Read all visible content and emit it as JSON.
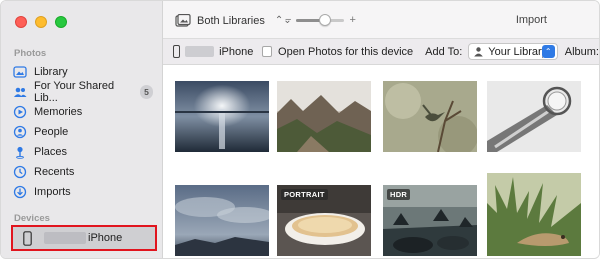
{
  "sidebar": {
    "photos_section": "Photos",
    "items": [
      {
        "label": "Library",
        "icon": "library-icon"
      },
      {
        "label": "For Your Shared Lib...",
        "icon": "shared-people-icon",
        "badge": "5"
      },
      {
        "label": "Memories",
        "icon": "memories-icon"
      },
      {
        "label": "People",
        "icon": "people-icon"
      },
      {
        "label": "Places",
        "icon": "places-pin-icon"
      },
      {
        "label": "Recents",
        "icon": "clock-icon"
      },
      {
        "label": "Imports",
        "icon": "imports-icon"
      }
    ],
    "devices_section": "Devices",
    "device": {
      "label": "iPhone",
      "icon": "phone-icon"
    }
  },
  "toolbar": {
    "library_filter": "Both Libraries",
    "zoom_minus": "−",
    "zoom_plus": "+",
    "zoom_level": 0.6,
    "import_label": "Import"
  },
  "importbar": {
    "device_label": "iPhone",
    "open_photos_label": "Open Photos for this device",
    "open_photos_checked": false,
    "add_to_label": "Add To:",
    "add_to_value": "Your Library",
    "album_label": "Album:"
  },
  "photos": [
    {
      "scene": "ocean-moon",
      "tag": ""
    },
    {
      "scene": "mountains",
      "tag": ""
    },
    {
      "scene": "hummingbird",
      "tag": ""
    },
    {
      "scene": "glass-bulb",
      "tag": ""
    },
    {
      "scene": "cloudy-sky",
      "tag": ""
    },
    {
      "scene": "pie",
      "tag": "PORTRAIT"
    },
    {
      "scene": "rocky-coast",
      "tag": "HDR"
    },
    {
      "scene": "lizard",
      "tag": ""
    }
  ],
  "colors": {
    "accent": "#2f7ae5",
    "highlight_border": "#e1141e",
    "sidebar_bg": "#e9e8ea"
  }
}
